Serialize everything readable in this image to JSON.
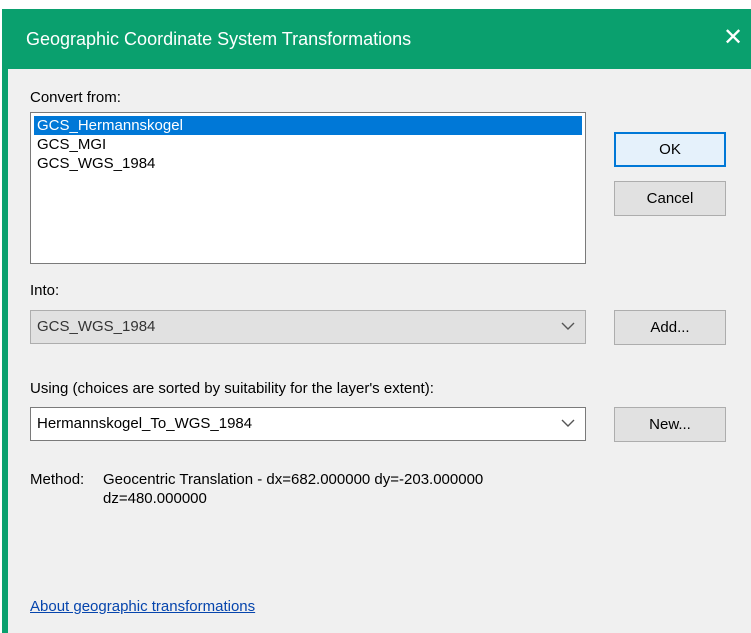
{
  "window": {
    "title": "Geographic Coordinate System Transformations"
  },
  "convert_from": {
    "label": "Convert from:",
    "items": [
      {
        "label": "GCS_Hermannskogel",
        "selected": true
      },
      {
        "label": "GCS_MGI",
        "selected": false
      },
      {
        "label": "GCS_WGS_1984",
        "selected": false
      }
    ]
  },
  "buttons": {
    "ok": "OK",
    "cancel": "Cancel",
    "add": "Add...",
    "new": "New..."
  },
  "into": {
    "label": "Into:",
    "value": "GCS_WGS_1984"
  },
  "using": {
    "label": "Using (choices are sorted by suitability for the layer's extent):",
    "value": "Hermannskogel_To_WGS_1984"
  },
  "method": {
    "label": "Method:",
    "line1": "Geocentric Translation - dx=682.000000 dy=-203.000000",
    "line2": "dz=480.000000"
  },
  "link": {
    "about": "About geographic transformations"
  },
  "colors": {
    "titlebar": "#0aa06e",
    "selection": "#0078d7",
    "link": "#0645ad"
  },
  "icons": {
    "close": "close-icon",
    "dropdown": "chevron-down-icon"
  }
}
